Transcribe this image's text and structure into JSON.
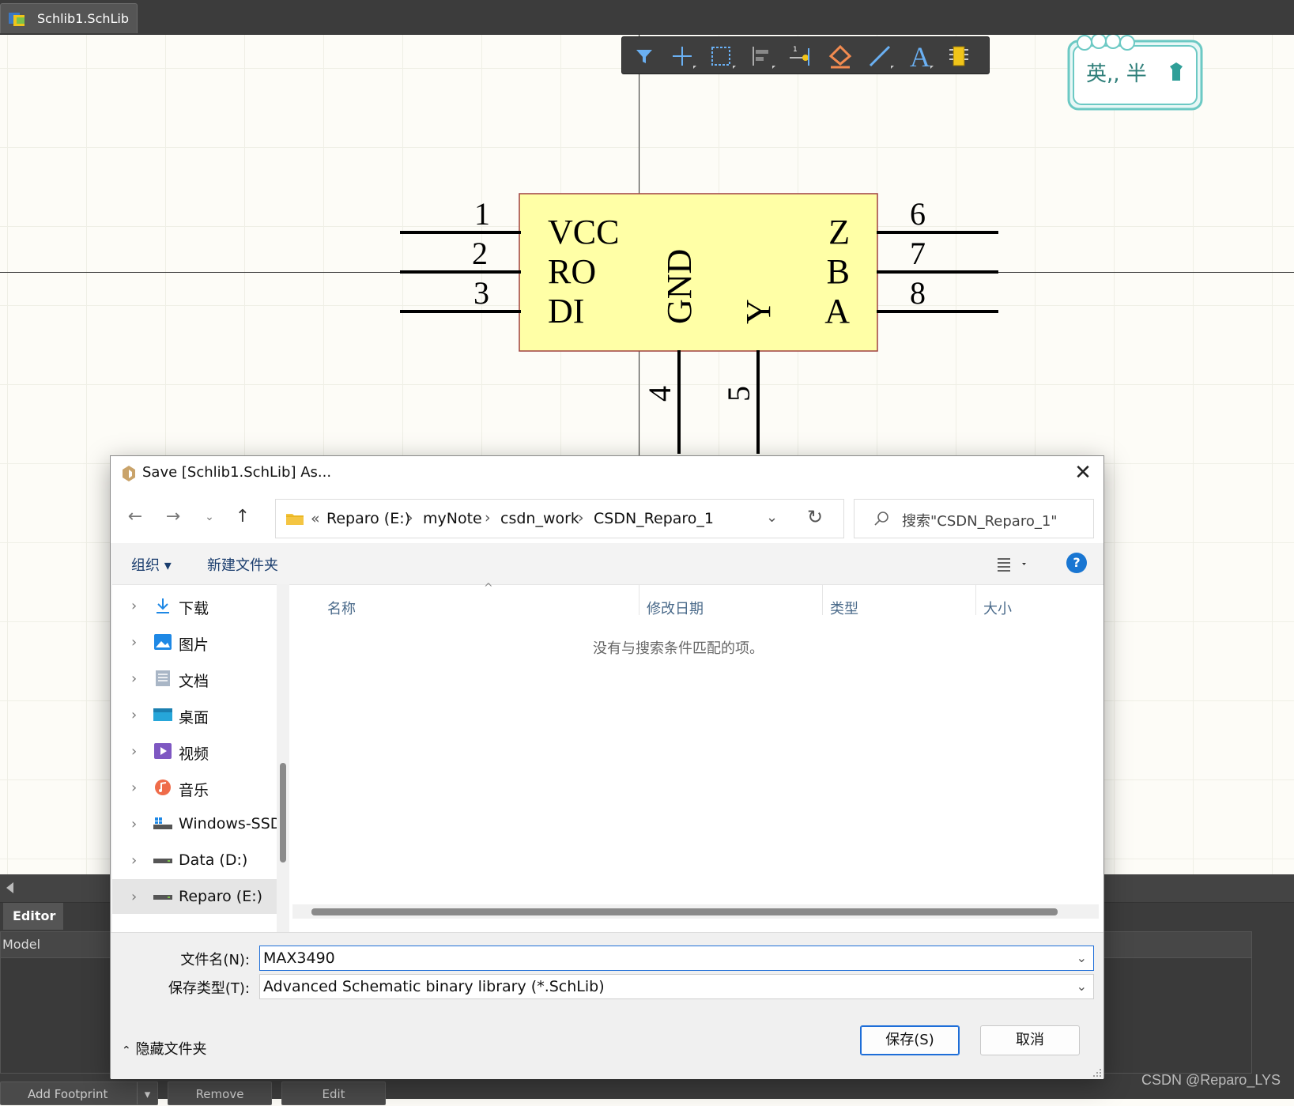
{
  "tabbar": {
    "tab_label": "Schlib1.SchLib *"
  },
  "component": {
    "pins_left": [
      {
        "number": "1",
        "name": "VCC"
      },
      {
        "number": "2",
        "name": "RO"
      },
      {
        "number": "3",
        "name": "DI"
      }
    ],
    "pins_right": [
      {
        "number": "6",
        "name": "Z"
      },
      {
        "number": "7",
        "name": "B"
      },
      {
        "number": "8",
        "name": "A"
      }
    ],
    "pins_bottom": [
      {
        "number": "4",
        "name": "GND"
      },
      {
        "number": "5",
        "name": "Y"
      }
    ],
    "body_color": "#ffffa6",
    "border_color": "#a04040"
  },
  "toolbar": {
    "tools": [
      "filter-icon",
      "move-icon",
      "select-rect-icon",
      "align-icon",
      "place-pin-icon",
      "fill-icon",
      "line-icon",
      "text-icon",
      "component-icon"
    ]
  },
  "sticker": {
    "text": "英,, 半"
  },
  "bottom_panel": {
    "editor_tab": "Editor",
    "model_header": "Model",
    "buttons": [
      "Add Footprint",
      "Remove",
      "Edit"
    ],
    "watermark": "CSDN @Reparo_LYS"
  },
  "dialog": {
    "title": "Save [Schlib1.SchLib] As...",
    "breadcrumb_prefix": "«",
    "breadcrumb": [
      "Reparo (E:)",
      "myNote",
      "csdn_work",
      "CSDN_Reparo_1"
    ],
    "search_placeholder": "搜索\"CSDN_Reparo_1\"",
    "organize": "组织 ▾",
    "new_folder": "新建文件夹",
    "help": "?",
    "nav_items": [
      {
        "label": "下载",
        "icon": "download-icon"
      },
      {
        "label": "图片",
        "icon": "pictures-icon"
      },
      {
        "label": "文档",
        "icon": "documents-icon"
      },
      {
        "label": "桌面",
        "icon": "desktop-icon"
      },
      {
        "label": "视频",
        "icon": "videos-icon"
      },
      {
        "label": "音乐",
        "icon": "music-icon"
      },
      {
        "label": "Windows-SSD",
        "icon": "drive-icon"
      },
      {
        "label": "Data (D:)",
        "icon": "drive-icon"
      },
      {
        "label": "Reparo (E:)",
        "icon": "drive-icon"
      }
    ],
    "columns": [
      "名称",
      "修改日期",
      "类型",
      "大小"
    ],
    "empty_message": "没有与搜索条件匹配的项。",
    "filename_label": "文件名(N):",
    "filename_value": "MAX3490",
    "filetype_label": "保存类型(T):",
    "filetype_value": "Advanced Schematic binary library (*.SchLib)",
    "hide_folders": "隐藏文件夹",
    "save_button": "保存(S)",
    "cancel_button": "取消"
  }
}
